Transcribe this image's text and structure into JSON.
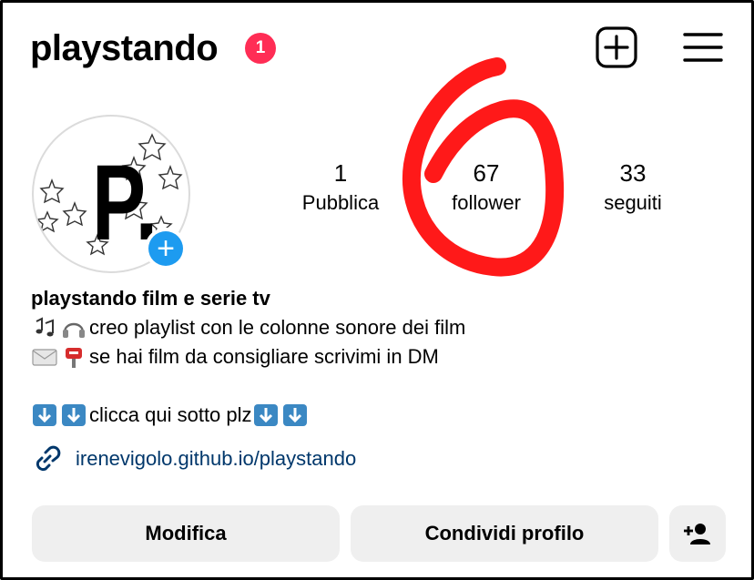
{
  "header": {
    "username": "playstando",
    "notification_count": "1",
    "new_post_icon": "plus-square-icon",
    "menu_icon": "hamburger-menu-icon"
  },
  "profile": {
    "avatar_text": "P.",
    "add_story_icon": "plus-circle-icon"
  },
  "stats": [
    {
      "value": "1",
      "label": "Pubblica"
    },
    {
      "value": "67",
      "label": "follower"
    },
    {
      "value": "33",
      "label": "seguiti"
    }
  ],
  "bio": {
    "name": "playstando film e serie tv",
    "line1_text": "creo playlist con le colonne sonore dei film",
    "line2_text": "se hai film da consigliare scrivimi in DM",
    "line3_text": "clicca qui sotto plz"
  },
  "link": {
    "text": "irenevigolo.github.io/playstando",
    "icon": "link-icon"
  },
  "actions": {
    "edit_label": "Modifica",
    "share_label": "Condividi profilo",
    "add_person_icon": "add-person-icon"
  },
  "colors": {
    "badge": "#ff2d55",
    "add_story": "#1d9bf0",
    "link": "#00376b",
    "button_bg": "#efefef",
    "annotation": "#ff0000"
  }
}
